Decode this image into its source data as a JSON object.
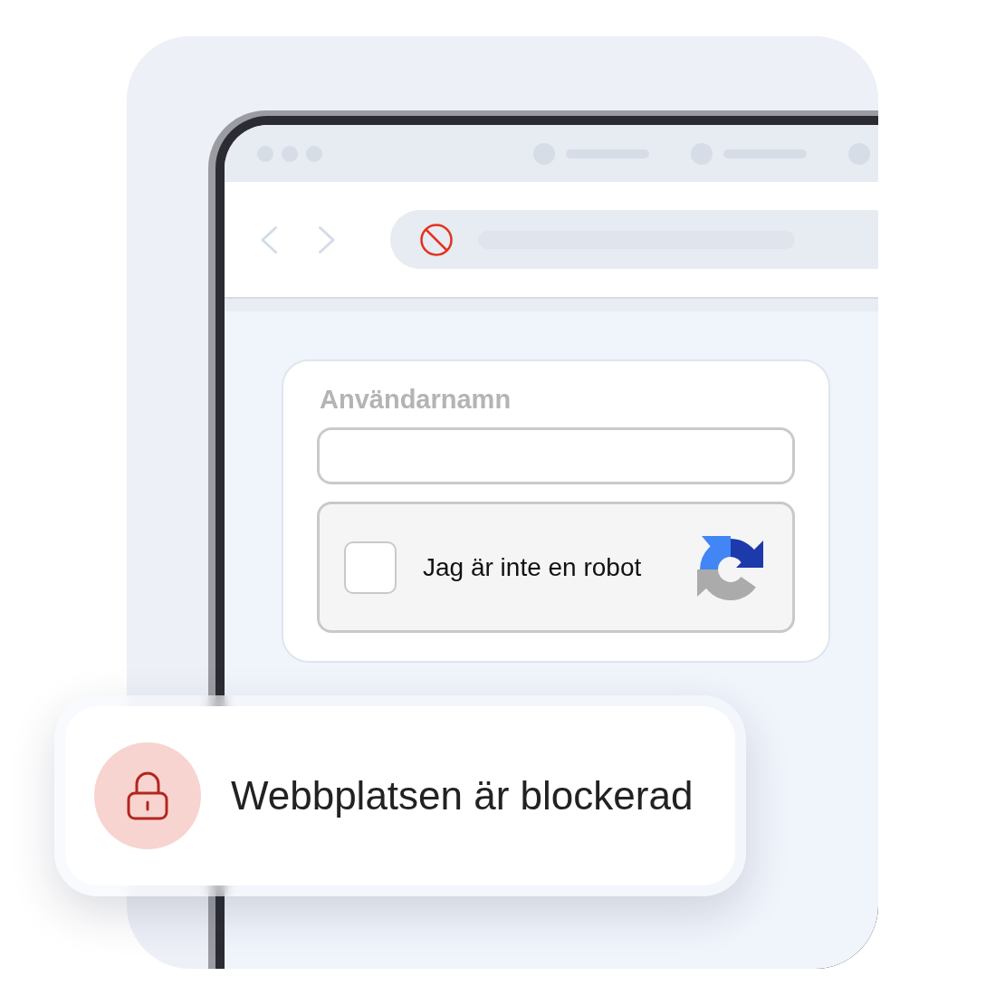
{
  "form": {
    "username": {
      "label": "Användarnamn"
    },
    "captcha": {
      "label": "Jag är inte en robot",
      "checked": false
    }
  },
  "alert": {
    "message": "Webbplatsen är blockerad"
  }
}
